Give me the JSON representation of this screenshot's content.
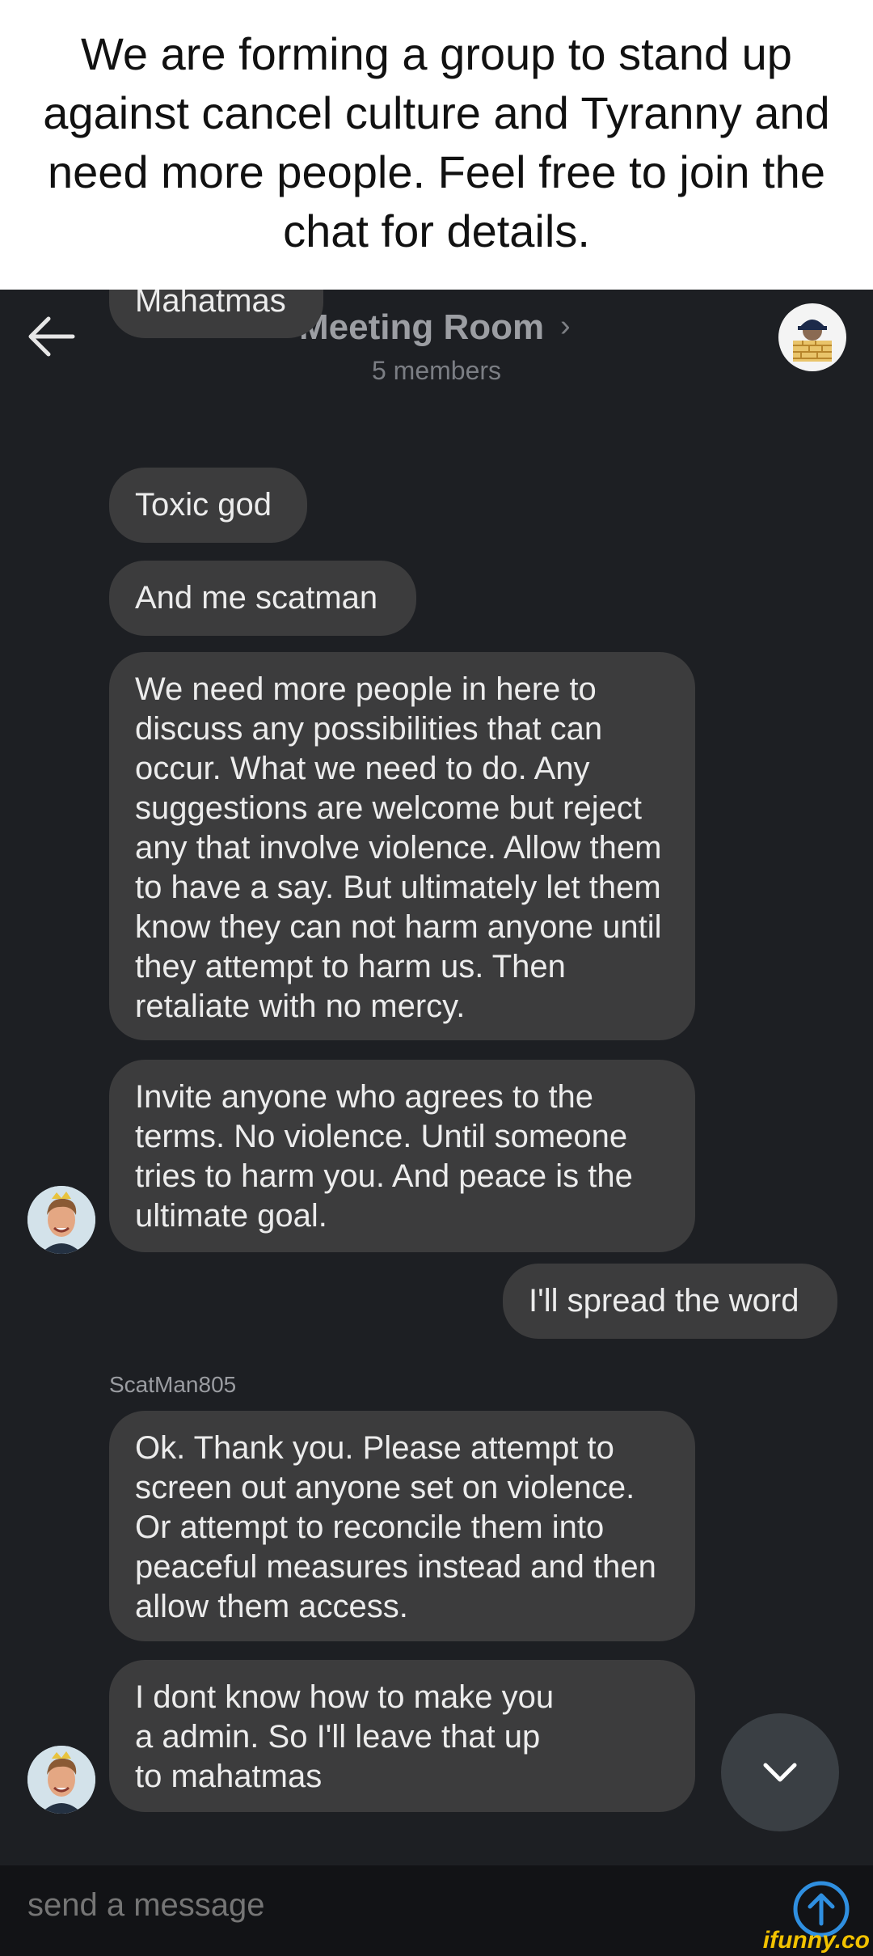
{
  "caption": "We are forming a group to stand up against cancel culture and Tyranny and need more people. Feel free to join the chat for details.",
  "header": {
    "title": "Meeting Room",
    "members": "5 members",
    "chevron": "›"
  },
  "messages": [
    {
      "text": "Mahatmas"
    },
    {
      "text": "Toxic god"
    },
    {
      "text": "And me scatman"
    },
    {
      "text": "We need more people in here to discuss any possibilities that can occur. What we need to do. Any suggestions are welcome but reject any that involve violence. Allow them to have a say. But ultimately let them know they can not harm anyone until they attempt to harm us. Then retaliate with no mercy."
    },
    {
      "text": "Invite anyone who agrees to the terms. No violence. Until someone tries to harm you. And peace is the ultimate goal."
    },
    {
      "text": "I'll spread the word"
    },
    {
      "text": "Ok. Thank you. Please attempt to screen out anyone set on violence. Or attempt to reconcile them into peaceful measures instead and then allow them access."
    },
    {
      "text": "I dont know how to make you a admin. So I'll leave that up to mahatmas"
    }
  ],
  "sender_name": "ScatMan805",
  "composer": {
    "placeholder": "send a message"
  },
  "watermark": "ifunny.co",
  "colors": {
    "background": "#1d1f23",
    "bubble": "#3c3c3d",
    "send_accent": "#2f8fe0",
    "composer_bg": "#121316"
  },
  "icons": [
    "back-arrow-icon",
    "chevron-down-icon",
    "send-arrow-icon"
  ]
}
